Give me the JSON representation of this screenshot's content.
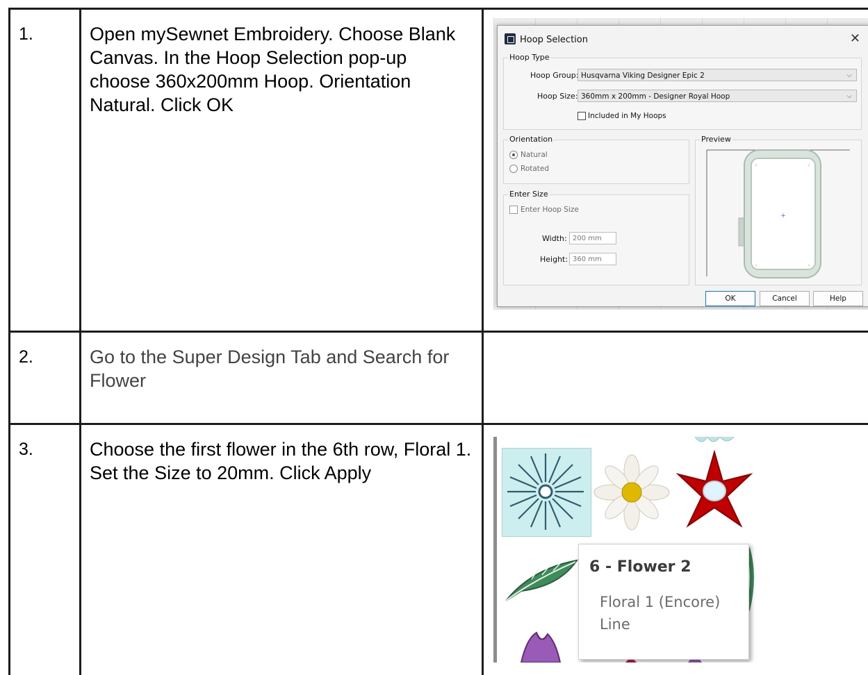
{
  "rows": [
    {
      "number": "1.",
      "text": "Open mySewnet Embroidery. Choose Blank Canvas. In the Hoop Selection pop-up choose 360x200mm Hoop. Orientation Natural. Click OK"
    },
    {
      "number": "2.",
      "text": "Go to the Super Design Tab and Search for Flower"
    },
    {
      "number": "3.",
      "text": "Choose the first flower in the 6th row, Floral 1.\nSet the Size to 20mm. Click Apply"
    }
  ],
  "hoop_dialog": {
    "title": "Hoop Selection",
    "hoop_type_label": "Hoop Type",
    "hoop_group_label": "Hoop Group:",
    "hoop_group_value": "Husqvarna Viking Designer Epic 2",
    "hoop_size_label": "Hoop Size:",
    "hoop_size_value": "360mm x 200mm - Designer Royal Hoop",
    "included_label": "Included in My Hoops",
    "orientation_label": "Orientation",
    "natural_label": "Natural",
    "rotated_label": "Rotated",
    "preview_label": "Preview",
    "enter_size_label": "Enter Size",
    "enter_hoop_size_label": "Enter Hoop Size",
    "width_label": "Width:",
    "width_value": "200 mm",
    "height_label": "Height:",
    "height_value": "360 mm",
    "ok_label": "OK",
    "cancel_label": "Cancel",
    "help_label": "Help"
  },
  "design_tooltip": {
    "title": "6 - Flower 2",
    "line1": "Floral 1 (Encore)",
    "line2": "Line"
  },
  "colors": {
    "tile_selected": "#cdeeee",
    "daisy_center": "#e0b800",
    "red_flower": "#c00000",
    "leaf": "#3e8c5a"
  }
}
